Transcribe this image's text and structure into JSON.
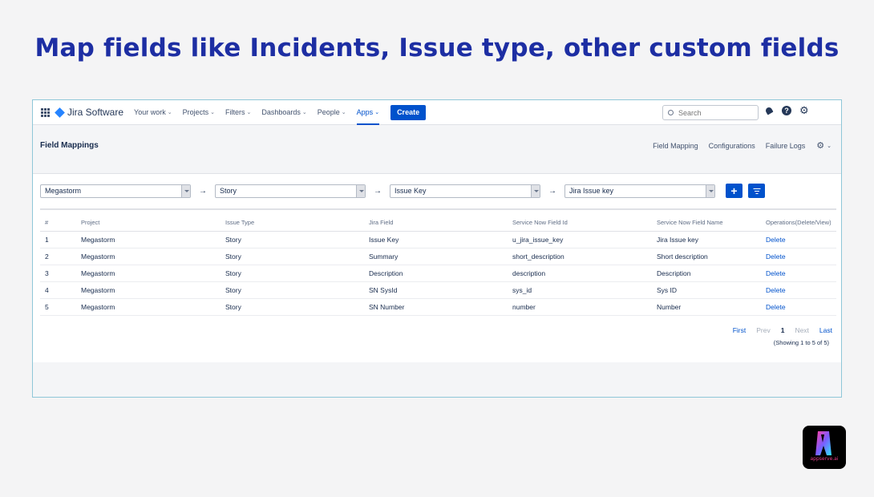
{
  "headline": "Map fields like Incidents, Issue type, other custom fields",
  "topnav": {
    "app_name": "Jira Software",
    "items": [
      {
        "label": "Your work"
      },
      {
        "label": "Projects"
      },
      {
        "label": "Filters"
      },
      {
        "label": "Dashboards"
      },
      {
        "label": "People"
      },
      {
        "label": "Apps"
      }
    ],
    "active_item": "Apps",
    "create_label": "Create",
    "search_placeholder": "Search",
    "icons": [
      "grid-icon",
      "bell-icon",
      "help-icon",
      "gear-icon"
    ]
  },
  "subheader": {
    "title": "Field Mappings",
    "links": [
      "Field Mapping",
      "Configurations",
      "Failure Logs"
    ]
  },
  "selects": {
    "project": "Megastorm",
    "issue_type": "Story",
    "jira_field": "Issue Key",
    "service_now_field": "Jira Issue key",
    "arrow": "→"
  },
  "buttons": {
    "add": "+"
  },
  "table": {
    "headers": [
      "#",
      "Project",
      "Issue Type",
      "Jira Field",
      "Service Now Field Id",
      "Service Now Field Name",
      "Operations(Delete/View)"
    ],
    "rows": [
      [
        "1",
        "Megastorm",
        "Story",
        "Issue Key",
        "u_jira_issue_key",
        "Jira Issue key",
        "Delete"
      ],
      [
        "2",
        "Megastorm",
        "Story",
        "Summary",
        "short_description",
        "Short description",
        "Delete"
      ],
      [
        "3",
        "Megastorm",
        "Story",
        "Description",
        "description",
        "Description",
        "Delete"
      ],
      [
        "4",
        "Megastorm",
        "Story",
        "SN SysId",
        "sys_id",
        "Sys ID",
        "Delete"
      ],
      [
        "5",
        "Megastorm",
        "Story",
        "SN Number",
        "number",
        "Number",
        "Delete"
      ]
    ]
  },
  "pager": {
    "first": "First",
    "prev": "Prev",
    "current": "1",
    "next": "Next",
    "last": "Last",
    "showing": "(Showing 1 to 5 of 5)"
  },
  "brand": {
    "name": "appserve.ai",
    "colors": {
      "accent": "#0052cc",
      "headline": "#1d2ea3"
    }
  }
}
